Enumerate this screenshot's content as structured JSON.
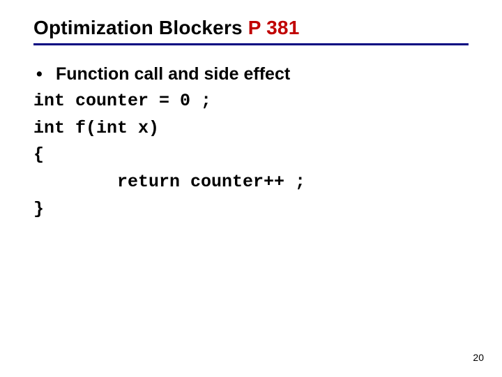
{
  "title": {
    "part1": "Optimization Blockers ",
    "part2": " P 381"
  },
  "bullet": {
    "dot": "•",
    "text": "Function call and side effect"
  },
  "code": {
    "l1": "int counter = 0 ;",
    "l2": "int f(int x)",
    "l3": "{",
    "l4": "    return counter++ ;",
    "l5": "}"
  },
  "page_number": "20"
}
